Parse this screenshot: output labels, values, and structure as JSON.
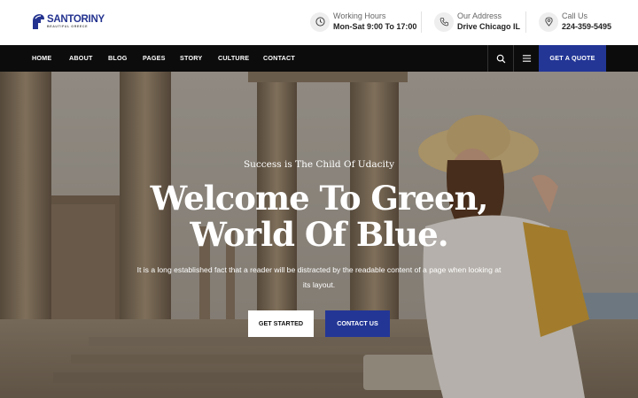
{
  "logo": {
    "name": "SANTORINY",
    "tagline": "BEAUTIFUL GREECE"
  },
  "header": {
    "info": [
      {
        "icon": "clock-icon",
        "label": "Working Hours",
        "value": "Mon-Sat 9:00 To 17:00"
      },
      {
        "icon": "phone-icon",
        "label": "Our Address",
        "value": "Drive Chicago IL"
      },
      {
        "icon": "location-pin-icon",
        "label": "Call Us",
        "value": "224-359-5495"
      }
    ]
  },
  "nav": {
    "items": [
      "HOME",
      "ABOUT",
      "BLOG",
      "PAGES",
      "STORY",
      "CULTURE",
      "CONTACT"
    ],
    "quote_label": "GET A QUOTE",
    "search_icon": "search-icon",
    "menu_icon": "hamburger-menu-icon"
  },
  "hero": {
    "tagline": "Success is The Child Of Udacity",
    "headline_line1": "Welcome To Green,",
    "headline_line2": "World Of Blue.",
    "description": "It is a long established fact that a reader will be distracted by the readable content of a page when looking at its layout.",
    "primary_button": "GET STARTED",
    "secondary_button": "CONTACT US"
  },
  "colors": {
    "brand": "#233696",
    "nav_bg": "#0c0c0c"
  }
}
